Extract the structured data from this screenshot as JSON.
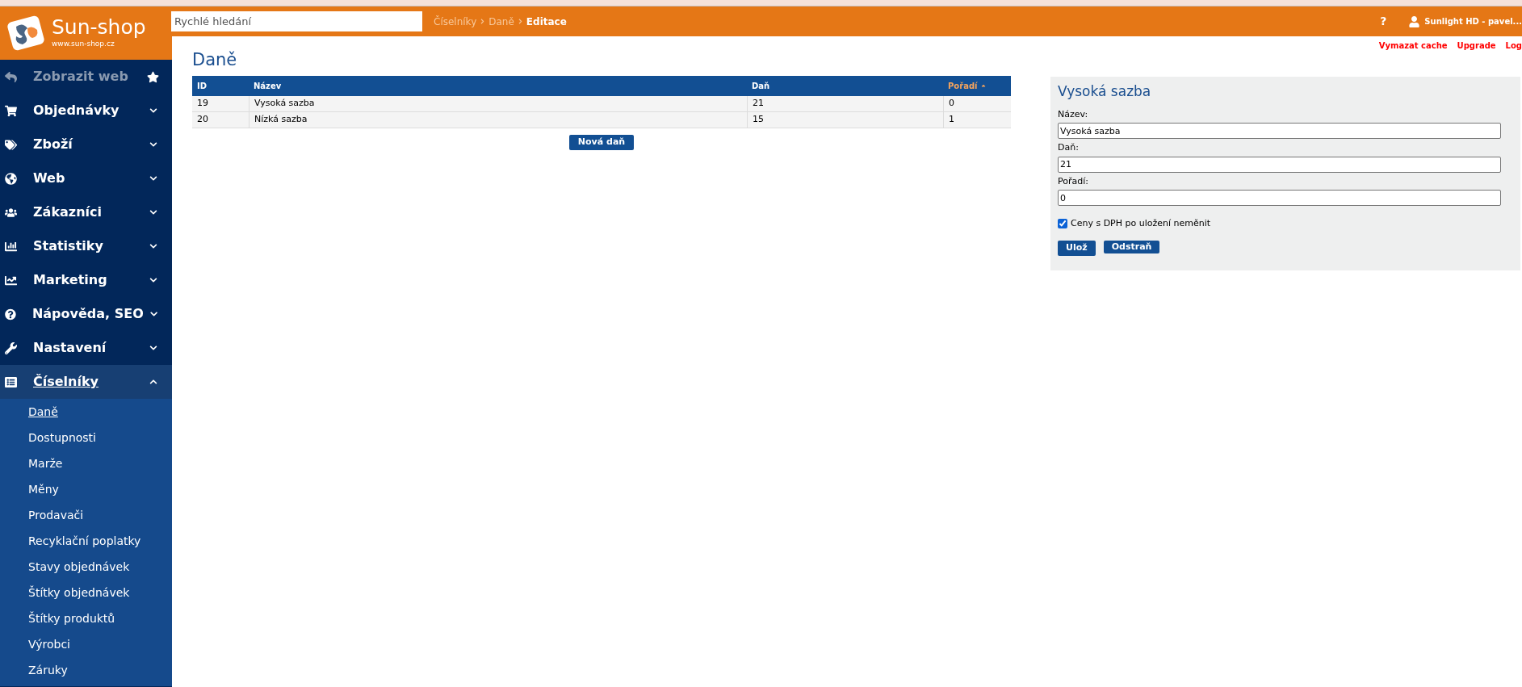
{
  "logo": {
    "name": "Sun-shop",
    "url": "www.sun-shop.cz"
  },
  "search": {
    "placeholder": "Rychlé hledání"
  },
  "breadcrumb": [
    {
      "label": "Číselníky",
      "current": false
    },
    {
      "label": "Daně",
      "current": false
    },
    {
      "label": "Editace",
      "current": true
    }
  ],
  "header": {
    "help": "?",
    "user": "Sunlight HD - pavel..."
  },
  "top_links": [
    "Vymazat cache",
    "Upgrade",
    "Log"
  ],
  "sidebar": {
    "items": [
      {
        "label": "Zobrazit web",
        "kind": "link",
        "expanded": false
      },
      {
        "label": "Objednávky",
        "kind": "menu",
        "expanded": false
      },
      {
        "label": "Zboží",
        "kind": "menu",
        "expanded": false
      },
      {
        "label": "Web",
        "kind": "menu",
        "expanded": false
      },
      {
        "label": "Zákazníci",
        "kind": "menu",
        "expanded": false
      },
      {
        "label": "Statistiky",
        "kind": "menu",
        "expanded": false
      },
      {
        "label": "Marketing",
        "kind": "menu",
        "expanded": false
      },
      {
        "label": "Nápověda, SEO",
        "kind": "menu",
        "expanded": false
      },
      {
        "label": "Nastavení",
        "kind": "menu",
        "expanded": false
      },
      {
        "label": "Číselníky",
        "kind": "menu",
        "expanded": true,
        "children": [
          {
            "label": "Daně",
            "selected": true
          },
          {
            "label": "Dostupnosti",
            "selected": false
          },
          {
            "label": "Marže",
            "selected": false
          },
          {
            "label": "Měny",
            "selected": false
          },
          {
            "label": "Prodavači",
            "selected": false
          },
          {
            "label": "Recyklační poplatky",
            "selected": false
          },
          {
            "label": "Stavy objednávek",
            "selected": false
          },
          {
            "label": "Štítky objednávek",
            "selected": false
          },
          {
            "label": "Štítky produktů",
            "selected": false
          },
          {
            "label": "Výrobci",
            "selected": false
          },
          {
            "label": "Záruky",
            "selected": false
          }
        ]
      }
    ]
  },
  "page": {
    "title": "Daně"
  },
  "table": {
    "columns": [
      {
        "label": "ID",
        "sorted": false
      },
      {
        "label": "Název",
        "sorted": false
      },
      {
        "label": "Daň",
        "sorted": false
      },
      {
        "label": "Pořadí",
        "sorted": true
      }
    ],
    "rows": [
      [
        "19",
        "Vysoká sazba",
        "21",
        "0"
      ],
      [
        "20",
        "Nízká sazba",
        "15",
        "1"
      ]
    ]
  },
  "new_button": "Nová daň",
  "edit_panel": {
    "title": "Vysoká sazba",
    "fields": [
      {
        "label": "Název:",
        "value": "Vysoká sazba"
      },
      {
        "label": "Daň:",
        "value": "21"
      },
      {
        "label": "Pořadí:",
        "value": "0"
      }
    ],
    "checkbox": {
      "label": "Ceny s DPH po uložení neměnit",
      "checked": true
    },
    "buttons": [
      "Ulož",
      "Odstraň"
    ]
  }
}
